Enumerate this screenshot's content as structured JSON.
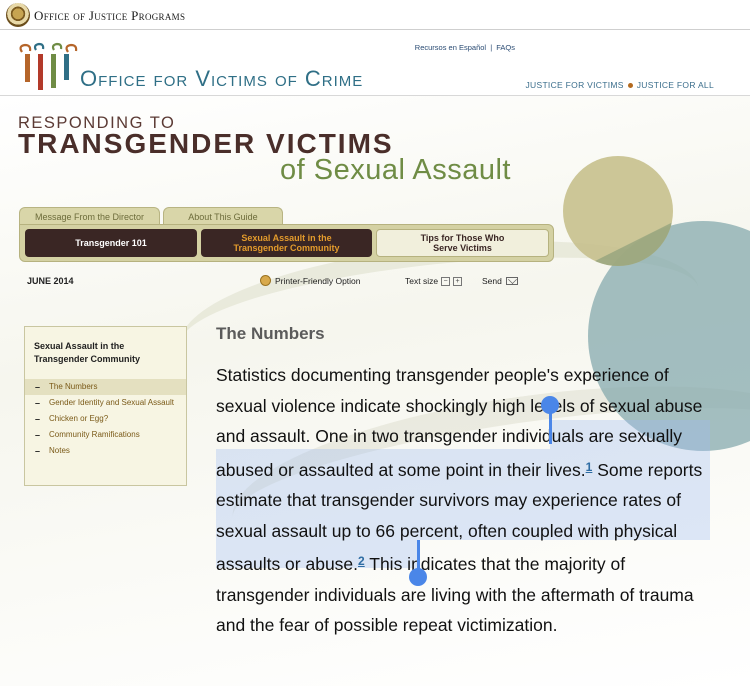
{
  "ojp": {
    "title": "Office of Justice Programs",
    "seal_icon": "doj-seal-icon"
  },
  "ovc": {
    "title": "Office for Victims of Crime",
    "links": {
      "spanish": "Recursos en Español",
      "separator": "|",
      "faqs": "FAQs"
    },
    "tagline": {
      "left": "JUSTICE FOR VICTIMS",
      "right": "JUSTICE FOR ALL"
    }
  },
  "banner": {
    "line1": "RESPONDING TO",
    "line2": "TRANSGENDER VICTIMS",
    "line3": "of Sexual Assault"
  },
  "tabs": {
    "director": "Message From the Director",
    "about": "About This Guide",
    "t101": "Transgender 101",
    "sa_line1": "Sexual Assault in the",
    "sa_line2": "Transgender Community",
    "tips_line1": "Tips for Those Who",
    "tips_line2": "Serve Victims"
  },
  "utility": {
    "date": "JUNE 2014",
    "printer": "Printer-Friendly Option",
    "text_size": "Text size",
    "minus": "−",
    "plus": "+",
    "send": "Send"
  },
  "sidebar": {
    "heading": "Sexual Assault in the Transgender Community",
    "items": [
      {
        "label": "The Numbers",
        "active": true
      },
      {
        "label": "Gender Identity and Sexual Assault",
        "active": false
      },
      {
        "label": "Chicken or Egg?",
        "active": false
      },
      {
        "label": "Community Ramifications",
        "active": false
      },
      {
        "label": "Notes",
        "active": false
      }
    ]
  },
  "main": {
    "title": "The Numbers",
    "p_a": "Statistics documenting transgender people's experience of sexual violence indicate shockingly high levels of sexual abuse and assault. ",
    "p_b": "One in two transgender individuals are sexually abused or assaulted at some point in their lives.",
    "fn1": "1",
    "p_c": " Some reports estimate that transgender survivors may experience rates of sexual assault up to 66 percent,",
    "p_d": " often coupled with physical assaults or abuse.",
    "fn2": "2",
    "p_e": " This indicates that the majority of transgender individuals are living with the aftermath of trauma and the fear of possible repeat victimization."
  },
  "colors": {
    "ovc_blue": "#2f6f86",
    "nav_dark": "#3a2624",
    "nav_orange": "#e39b2c",
    "tab_khaki": "#d4d1a3",
    "selection_blue": "#4a86e8"
  }
}
